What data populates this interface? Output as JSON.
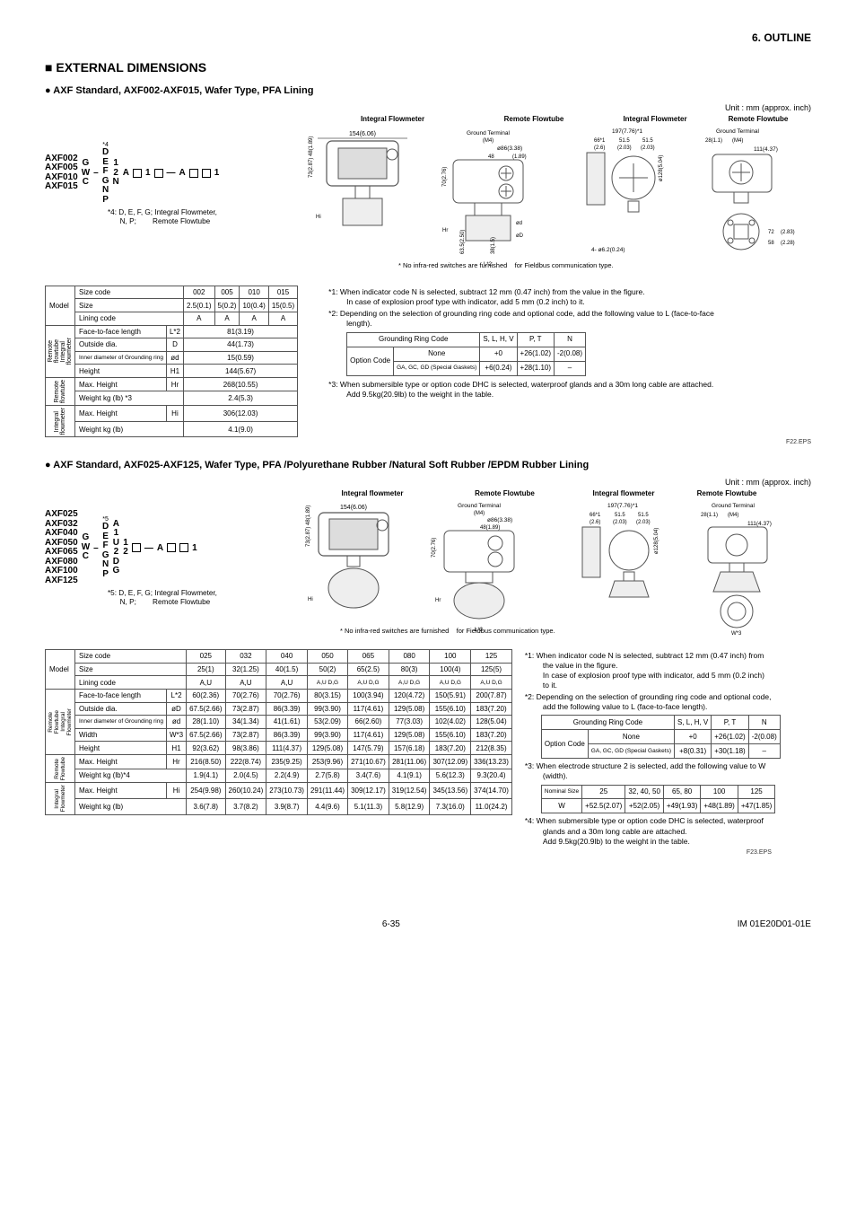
{
  "page": {
    "outline_header": "6.  OUTLINE",
    "section_title": "EXTERNAL DIMENSIONS",
    "footer_left": "6-35",
    "footer_right": "IM 01E20D01-01E"
  },
  "unit_label": "Unit : mm (approx. inch)",
  "top": {
    "subtitle": "AXF Standard, AXF002-AXF015, Wafer Type, PFA Lining",
    "model_prefix": [
      "AXF002",
      "AXF005",
      "AXF010",
      "AXF015"
    ],
    "code_suffix_letters1": [
      "G",
      "W",
      "C"
    ],
    "code_suffix_letters2": [
      "D",
      "E",
      "F",
      "G",
      "N",
      "P"
    ],
    "code_suffix_letters3": [
      "1",
      "2",
      "N"
    ],
    "star4_label": "*4",
    "middle_text": [
      "A",
      "1",
      "—",
      "A",
      "1"
    ],
    "note4": "*4: D, E, F, G; Integral Flowmeter,\n      N, P;        Remote Flowtube",
    "diag_labels": {
      "integral_flowmeter": "Integral Flowmeter",
      "remote_flowtube": "Remote Flowtube",
      "dim_154": "154(6.06)",
      "ground_terminal": "Ground Terminal",
      "m4": "(M4)",
      "phi86": "ø86(3.38)",
      "n48": "48",
      "n189": "(1.89)",
      "v73_48": "73(2.87)  48(1.89)",
      "v70": "70(2.76)",
      "v63_5": "63.5(2.50)",
      "v38": "38(1.5)",
      "Hi": "Hi",
      "Hr": "Hr",
      "øD": "øD",
      "ød": "ød",
      "H1": "H1",
      "L2": "L*2",
      "fieldbus": "* No infra-red switches are furnished\n   for Fieldbus communication type.",
      "n197": "197(7.76)*1",
      "n66": "66*1",
      "n51a": "51.5",
      "n51b": "51.5",
      "n26": "(2.6)",
      "n203a": "(2.03)",
      "n203b": "(2.03)",
      "n128": "ø128(5.04)",
      "n4phi62": "4- ø6.2(0.24)",
      "n28": "28(1.1)",
      "n111": "111(4.37)",
      "n72": "72",
      "n283": "(2.83)",
      "n58": "58",
      "n228": "(2.28)",
      "ground_terminal_r": "Ground Terminal",
      "m4r": "(M4)"
    },
    "table": {
      "cols": [
        "002",
        "005",
        "010",
        "015"
      ],
      "rows": [
        {
          "k": "model",
          "l": "Model",
          "sub": "Size",
          "v": [
            "2.5(0.1)",
            "5(0.2)",
            "10(0.4)",
            "15(0.5)"
          ]
        },
        {
          "k": "lining",
          "l": "Lining code",
          "v": [
            "A",
            "A",
            "A",
            "A"
          ]
        },
        {
          "k": "ftf",
          "l": "Face-to-face length",
          "sym": "L*2",
          "v": "81(3.19)",
          "span": 4
        },
        {
          "k": "outdia",
          "l": "Outside dia.",
          "sym": "D",
          "v": "44(1.73)",
          "span": 4
        },
        {
          "k": "indiat",
          "l": "Inner diameter of Grounding ring",
          "sym": "ød",
          "v": "15(0.59)",
          "span": 4
        },
        {
          "k": "height",
          "l": "Height",
          "sym": "H1",
          "v": "144(5.67)",
          "span": 4
        },
        {
          "k": "maxh_r",
          "l": "Max. Height",
          "sym": "Hr",
          "v": "268(10.55)",
          "span": 4
        },
        {
          "k": "wkg_r",
          "l": "Weight kg (lb) *3",
          "v": "2.4(5.3)",
          "span": 4
        },
        {
          "k": "maxh_i",
          "l": "Max. Height",
          "sym": "Hi",
          "v": "306(12.03)",
          "span": 4
        },
        {
          "k": "wkg_i",
          "l": "Weight kg (lb)",
          "v": "4.1(9.0)",
          "span": 4
        }
      ],
      "row_groups": [
        "",
        "",
        "Remote flowtube Integral flowmeter",
        "",
        "",
        "",
        "Remote flowtube",
        "",
        "Integral flowmeter",
        ""
      ],
      "size_code_label": "Size code",
      "size_label": "Size"
    },
    "notes": [
      "*1: When indicator code N is selected, subtract 12 mm (0.47 inch) from the value in the figure.\n      In case of explosion proof type with indicator, add 5 mm (0.2 inch) to it.",
      "*2: Depending on the selection of grounding ring code and optional code, add the following value to L (face-to-face length).",
      "*3: When submersible type or option code DHC is selected, waterproof glands and a 30m long cable are attached.\n      Add 9.5kg(20.9lb) to the weight in the table."
    ],
    "ground_tbl": {
      "headers": [
        "Grounding Ring Code",
        "S, L, H, V",
        "P, T",
        "N"
      ],
      "option_code": "Option Code",
      "rows": [
        [
          "None",
          "+0",
          "+26(1.02)",
          "-2(0.08)"
        ],
        [
          "GA, GC, GD (Special Gaskets)",
          "+6(0.24)",
          "+28(1.10)",
          "–"
        ]
      ]
    },
    "eps": "F22.EPS"
  },
  "bot": {
    "subtitle": "AXF Standard, AXF025-AXF125, Wafer Type, PFA /Polyurethane Rubber /Natural Soft Rubber /EPDM Rubber Lining",
    "model_prefix": [
      "AXF025",
      "AXF032",
      "AXF040",
      "AXF050",
      "AXF065",
      "AXF080",
      "AXF100",
      "AXF125"
    ],
    "code_suffix_letters1": [
      "G",
      "W",
      "C"
    ],
    "code_suffix_letters2": [
      "D",
      "E",
      "F",
      "G",
      "N",
      "P"
    ],
    "code_suffix_letters3": [
      "A",
      "1",
      "U",
      "2",
      "D",
      "G"
    ],
    "star5_label": "*5",
    "middle_text": [
      "1",
      "2",
      "—",
      "A",
      "1"
    ],
    "note5": "*5: D, E, F, G; Integral Flowmeter,\n      N, P;        Remote Flowtube",
    "diag_labels": {
      "integral_flowmeter": "Integral flowmeter",
      "remote_flowtube": "Remote Flowtube",
      "dim_154": "154(6.06)",
      "ground_terminal": "Ground Terminal",
      "m4": "(M4)",
      "phi86": "ø86(3.38)",
      "n48": "48(1.89)",
      "v73_48": "73(2.87)  48(1.89)",
      "v70": "70(2.76)",
      "fieldbus": "* No infra-red switches are furnished\n   for Fieldbus communication type.",
      "n197": "197(7.76)*1",
      "n66": "66*1",
      "n51a": "51.5",
      "n51b": "51.5",
      "n26": "(2.6)",
      "n203a": "(2.03)",
      "n203b": "(2.03)",
      "n128": "ø128(5.04)",
      "n28": "28(1.1)",
      "n111": "111(4.37)",
      "ground_terminal_r": "Ground Terminal",
      "m4r": "(M4)",
      "Hi": "Hi",
      "Hr": "Hr",
      "øD": "øD",
      "ød": "ød",
      "H1": "H1",
      "L2": "L*2",
      "W3": "W*3"
    },
    "table": {
      "cols": [
        "025",
        "032",
        "040",
        "050",
        "065",
        "080",
        "100",
        "125"
      ],
      "size": [
        "25(1)",
        "32(1.25)",
        "40(1.5)",
        "50(2)",
        "65(2.5)",
        "80(3)",
        "100(4)",
        "125(5)"
      ],
      "lining": [
        "A,U",
        "A,U",
        "A,U",
        "A,U D,G",
        "A,U D,G",
        "A,U D,G",
        "A,U D,G",
        "A,U D,G"
      ],
      "ftf": [
        "60(2.36)",
        "70(2.76)",
        "70(2.76)",
        "80(3.15)",
        "100(3.94)",
        "120(4.72)",
        "150(5.91)",
        "200(7.87)"
      ],
      "out": [
        "67.5(2.66)",
        "73(2.87)",
        "86(3.39)",
        "99(3.90)",
        "117(4.61)",
        "129(5.08)",
        "155(6.10)",
        "183(7.20)"
      ],
      "ind": [
        "28(1.10)",
        "34(1.34)",
        "41(1.61)",
        "53(2.09)",
        "66(2.60)",
        "77(3.03)",
        "102(4.02)",
        "128(5.04)"
      ],
      "width": [
        "67.5(2.66)",
        "73(2.87)",
        "86(3.39)",
        "99(3.90)",
        "117(4.61)",
        "129(5.08)",
        "155(6.10)",
        "183(7.20)"
      ],
      "height": [
        "92(3.62)",
        "98(3.86)",
        "111(4.37)",
        "129(5.08)",
        "147(5.79)",
        "157(6.18)",
        "183(7.20)",
        "212(8.35)"
      ],
      "maxh_r": [
        "216(8.50)",
        "222(8.74)",
        "235(9.25)",
        "253(9.96)",
        "271(10.67)",
        "281(11.06)",
        "307(12.09)",
        "336(13.23)"
      ],
      "wkg_r": [
        "1.9(4.1)",
        "2.0(4.5)",
        "2.2(4.9)",
        "2.7(5.8)",
        "3.4(7.6)",
        "4.1(9.1)",
        "5.6(12.3)",
        "9.3(20.4)"
      ],
      "maxh_i": [
        "254(9.98)",
        "260(10.24)",
        "273(10.73)",
        "291(11.44)",
        "309(12.17)",
        "319(12.54)",
        "345(13.56)",
        "374(14.70)"
      ],
      "wkg_i": [
        "3.6(7.8)",
        "3.7(8.2)",
        "3.9(8.7)",
        "4.4(9.6)",
        "5.1(11.3)",
        "5.8(12.9)",
        "7.3(16.0)",
        "11.0(24.2)"
      ],
      "labels": {
        "size_code": "Size code",
        "model": "Model",
        "size": "Size",
        "lining": "Lining code",
        "ftf": "Face-to-face length",
        "ftf_sym": "L*2",
        "out": "Outside dia.",
        "out_sym": "øD",
        "ind": "Inner diameter of Grounding ring",
        "ind_sym": "ød",
        "width": "Width",
        "width_sym": "W*3",
        "height": "Height",
        "height_sym": "H1",
        "maxh": "Max. Height",
        "hr": "Hr",
        "hi": "Hi",
        "wkg_r": "Weight kg (lb)*4",
        "wkg": "Weight kg (lb)",
        "g_remote": "Remote Flowtube",
        "g_intfm": "Integral Flowmeter"
      }
    },
    "notes": [
      "*1: When indicator code N is selected, subtract 12 mm (0.47 inch) from the value in the figure.\n      In case of explosion proof type with indicator, add 5 mm (0.2 inch) to it.",
      "*2: Depending on the selection of grounding ring code and optional code, add the following value to L (face-to-face length).",
      "*3: When electrode structure 2 is selected, add the following value to W (width).",
      "*4: When submersible type or option code DHC is selected, waterproof glands and a 30m long cable are attached.\n      Add 9.5kg(20.9lb) to the weight in the table."
    ],
    "ground_tbl": {
      "headers": [
        "Grounding Ring Code",
        "S, L, H, V",
        "P, T",
        "N"
      ],
      "option_code": "Option Code",
      "rows": [
        [
          "None",
          "+0",
          "+26(1.02)",
          "-2(0.08)"
        ],
        [
          "GA, GC, GD (Special Gaskets)",
          "+8(0.31)",
          "+30(1.18)",
          "–"
        ]
      ]
    },
    "nom_tbl": {
      "h1": "Nominal Size",
      "hvals": [
        "25",
        "32, 40, 50",
        "65, 80",
        "100",
        "125"
      ],
      "r1": "W",
      "rvals": [
        "+52.5(2.07)",
        "+52(2.05)",
        "+49(1.93)",
        "+48(1.89)",
        "+47(1.85)"
      ]
    },
    "eps": "F23.EPS"
  }
}
